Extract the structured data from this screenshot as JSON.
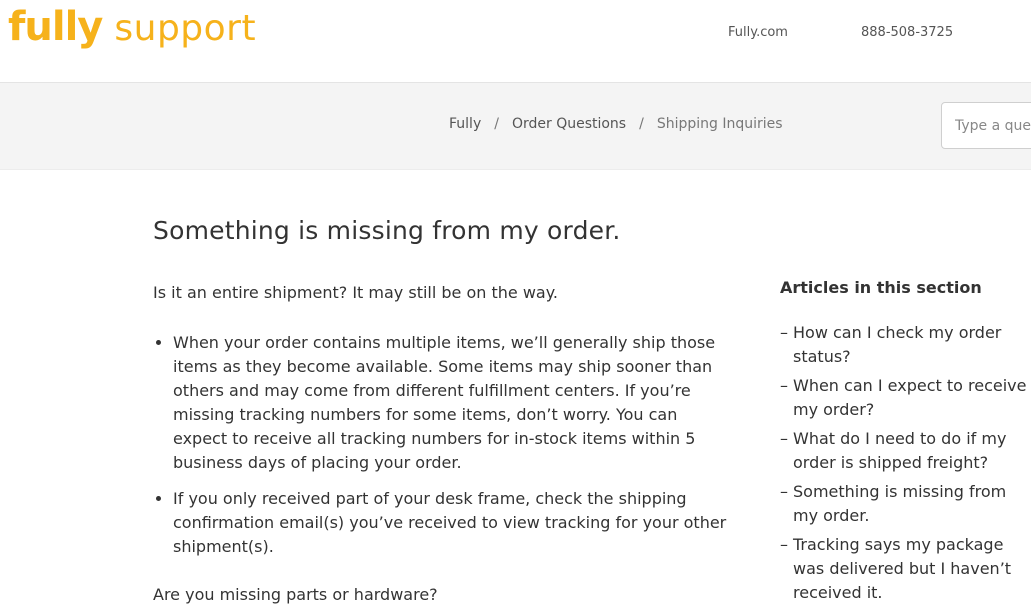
{
  "header": {
    "logo_primary": "fully",
    "logo_secondary": "support",
    "site_link": "Fully.com",
    "phone_link": "888-508-3725"
  },
  "breadcrumbs": [
    "Fully",
    "Order Questions",
    "Shipping Inquiries"
  ],
  "breadcrumb_separator": "/",
  "search": {
    "placeholder": "Type a question"
  },
  "article": {
    "title": "Something is missing from my order.",
    "intro": "Is it an entire shipment? It may still be on the way.",
    "bullets": [
      "When your order contains multiple items, we’ll generally ship those items as they become available. Some items may ship sooner than others and may come from different fulfillment centers. If you’re missing tracking numbers for some items, don’t worry. You can expect to receive all tracking numbers for in-stock items within 5 business days of placing your order.",
      "If you only received part of your desk frame, check the shipping confirmation email(s) you’ve received to view tracking for your other shipment(s)."
    ],
    "second_heading": "Are you missing parts or hardware?"
  },
  "sidebar": {
    "title": "Articles in this section",
    "dash": "–",
    "items": [
      "How can I check my order status?",
      "When can I expect to receive my order?",
      "What do I need to do if my order is shipped freight?",
      "Something is missing from my order.",
      "Tracking says my package was delivered but I haven’t received it."
    ]
  }
}
